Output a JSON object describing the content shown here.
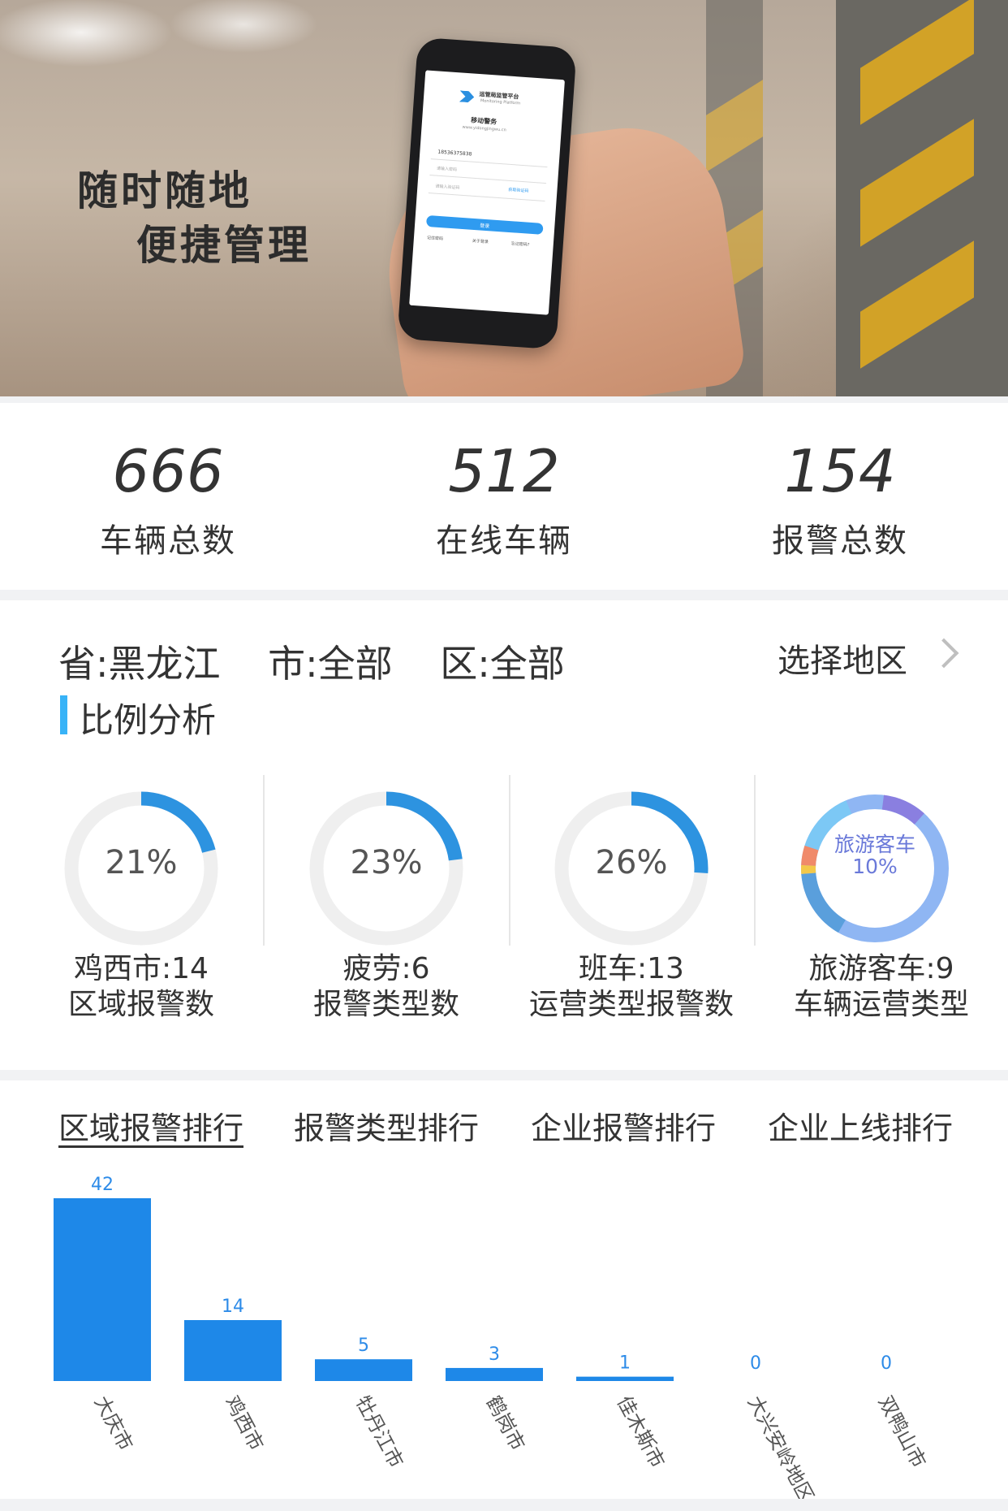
{
  "banner": {
    "slogan_line1": "随时随地",
    "slogan_line2": "便捷管理",
    "phone": {
      "app_title": "运管局监管平台",
      "app_subtitle": "Monitoring Platform",
      "app_name": "移动警务",
      "url": "www.yidongjingwu.cn",
      "username": "18536375838",
      "password_placeholder": "请输入密码",
      "code_placeholder": "请输入验证码",
      "get_code": "获取验证码",
      "login_button": "登录",
      "remember": "记住密码",
      "about": "关于登录",
      "forgot": "忘记密码?"
    }
  },
  "stats": [
    {
      "value": "666",
      "label": "车辆总数"
    },
    {
      "value": "512",
      "label": "在线车辆"
    },
    {
      "value": "154",
      "label": "报警总数"
    }
  ],
  "region": {
    "province": "省:黑龙江",
    "city": "市:全部",
    "district": "区:全部",
    "select_label": "选择地区"
  },
  "ratio": {
    "title": "比例分析",
    "items": [
      {
        "percent_label": "21%",
        "fraction": 0.21,
        "line1": "鸡西市:14",
        "line2": "区域报警数"
      },
      {
        "percent_label": "23%",
        "fraction": 0.23,
        "line1": "疲劳:6",
        "line2": "报警类型数"
      },
      {
        "percent_label": "26%",
        "fraction": 0.26,
        "line1": "班车:13",
        "line2": "运营类型报警数"
      },
      {
        "inner_line1": "旅游客车",
        "inner_line2": "10%",
        "line1": "旅游客车:9",
        "line2": "车辆运营类型"
      }
    ],
    "colors": {
      "arc": "#2d93e0",
      "track": "#efefef"
    },
    "pie_segment_colors": [
      "#8fb6f3",
      "#5a9fdc",
      "#f3c84a",
      "#f08a6a",
      "#8a7fe0",
      "#7cc8f5"
    ]
  },
  "tabs": [
    "区域报警排行",
    "报警类型排行",
    "企业报警排行",
    "企业上线排行"
  ],
  "chart_data": {
    "type": "bar",
    "categories": [
      "大庆市",
      "鸡西市",
      "牡丹江市",
      "鹤岗市",
      "佳木斯市",
      "大兴安岭地区",
      "双鸭山市"
    ],
    "values": [
      42,
      14,
      5,
      3,
      1,
      0,
      0
    ],
    "ylim": [
      0,
      42
    ],
    "bar_color": "#1e88e8"
  }
}
